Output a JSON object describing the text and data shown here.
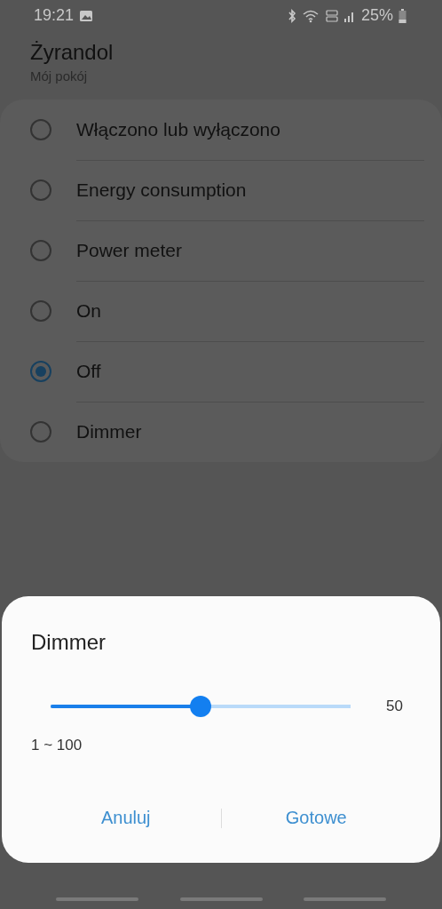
{
  "status_bar": {
    "time": "19:21",
    "battery": "25%"
  },
  "header": {
    "title": "Żyrandol",
    "subtitle": "Mój pokój"
  },
  "options": [
    {
      "label": "Włączono lub wyłączono",
      "selected": false
    },
    {
      "label": "Energy consumption",
      "selected": false
    },
    {
      "label": "Power meter",
      "selected": false
    },
    {
      "label": "On",
      "selected": false
    },
    {
      "label": "Off",
      "selected": true
    },
    {
      "label": "Dimmer",
      "selected": false
    }
  ],
  "dialog": {
    "title": "Dimmer",
    "slider": {
      "level": 0.5,
      "reading": "50",
      "range": "1 ~ 100"
    },
    "buttons": [
      "Anuluj",
      "Gotowe"
    ]
  }
}
